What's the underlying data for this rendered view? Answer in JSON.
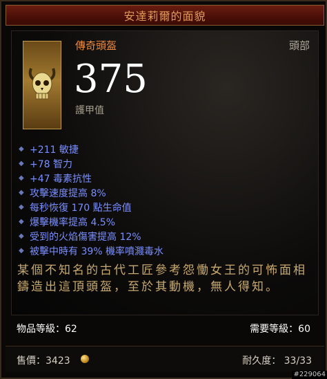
{
  "title": "安達莉爾的面貌",
  "item": {
    "type": "傳奇頭盔",
    "slot": "頭部",
    "armor_value": "375",
    "armor_label": "護甲值"
  },
  "stats": [
    "+211 敏捷",
    "+78 智力",
    "+47 毒素抗性",
    "攻擊速度提高 8%",
    "每秒恢復 170 點生命值",
    "爆擊機率提高 4.5%",
    "受到的火焰傷害提高 12%",
    "被擊中時有 39% 機率噴濺毒水"
  ],
  "flavor_text": "某個不知名的古代工匠參考怨慟女王的可怖面相鑄造出這頂頭盔，至於其動機，無人得知。",
  "levels": {
    "item_level": "物品等級：62",
    "required_level": "需要等級：60"
  },
  "footer": {
    "price": "售價：3423",
    "durability": "耐久度： 33/33"
  },
  "watermark": "#229064",
  "colors": {
    "legendary": "#f08a40",
    "magic_stat": "#7a8fff",
    "flavor": "#c8aa70"
  }
}
